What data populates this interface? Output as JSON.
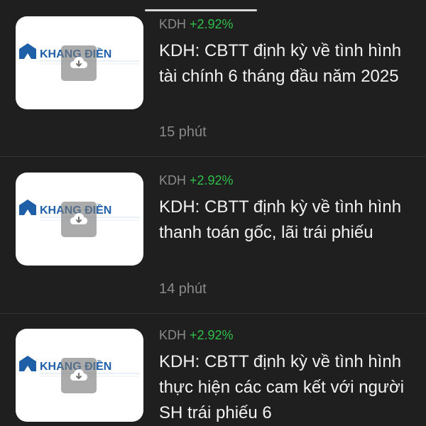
{
  "items": [
    {
      "ticker": "KDH",
      "change": "+2.92%",
      "title": "KDH: CBTT định kỳ về tình hình tài chính 6 tháng đầu năm 2025",
      "time": "15 phút",
      "thumb_logo_text": "KHANG ĐIỀN",
      "thumb_icon": "cloud-download-icon"
    },
    {
      "ticker": "KDH",
      "change": "+2.92%",
      "title": "KDH: CBTT định kỳ về tình hình thanh toán gốc, lãi trái phiếu",
      "time": "14 phút",
      "thumb_logo_text": "KHANG ĐIỀN",
      "thumb_icon": "cloud-download-icon"
    },
    {
      "ticker": "KDH",
      "change": "+2.92%",
      "title": "KDH: CBTT định kỳ về tình hình thực hiện các cam kết với người SH trái phiếu 6",
      "time": "",
      "thumb_logo_text": "KHANG ĐIỀN",
      "thumb_icon": "cloud-download-icon"
    }
  ],
  "colors": {
    "background": "#1f1f1f",
    "positive_change": "#2fbf4a",
    "muted_text": "#8a8a8a",
    "logo_blue": "#1f5fa8"
  }
}
